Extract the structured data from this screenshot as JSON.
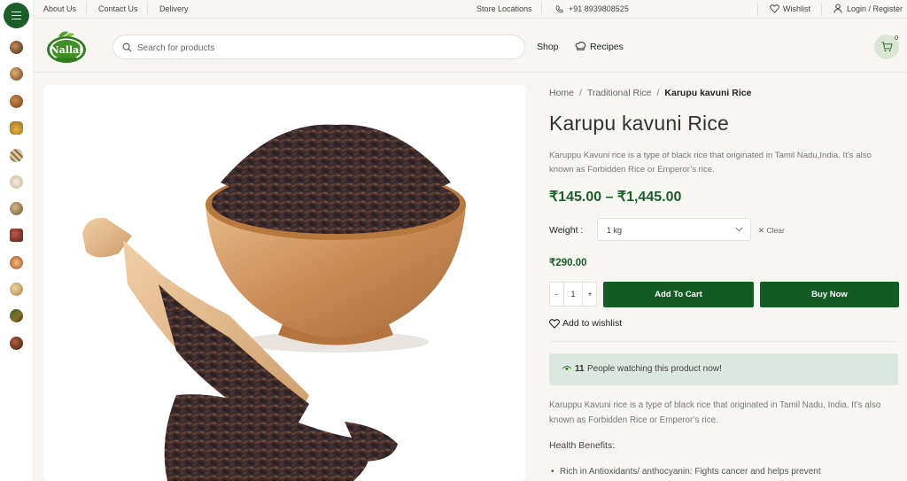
{
  "topbar": {
    "about": "About Us",
    "contact": "Contact Us",
    "delivery": "Delivery",
    "stores": "Store Locations",
    "phone": "+91 8939808525",
    "wishlist": "Wishlist",
    "login": "Login / Register"
  },
  "header": {
    "logo_text": "Nallal",
    "search_placeholder": "Search for products",
    "nav_shop": "Shop",
    "nav_recipes": "Recipes",
    "cart_count": "0"
  },
  "sidebar": {
    "category_count": 12
  },
  "product": {
    "breadcrumb": [
      "Home",
      "Traditional Rice",
      "Karupu kavuni Rice"
    ],
    "title": "Karupu kavuni Rice",
    "short_desc": "Karuppu Kavuni rice is a type of black rice that originated in Tamil Nadu,India. It’s also known as Forbidden Rice or Emperor’s rice.",
    "price_range": "₹145.00 – ₹1,445.00",
    "weight_label": "Weight :",
    "weight_selected": "1 kg",
    "clear_label": "Clear",
    "variation_price": "₹290.00",
    "qty_minus": "-",
    "qty_value": "1",
    "qty_plus": "+",
    "add_to_cart": "Add To Cart",
    "buy_now": "Buy Now",
    "add_to_wishlist": "Add to wishlist",
    "watching_count": "11",
    "watching_text": "People watching this product now!",
    "long_desc": "Karuppu Kavuni rice is a type of black rice that originated in Tamil Nadu, India. It’s also known as Forbidden Rice or Emperor’s rice.",
    "health_title": "Health Benefits:",
    "benefits": [
      "Rich in Antioxidants/ anthocyanin:  Fights cancer  and helps prevent"
    ]
  },
  "colors": {
    "brand_green": "#155b25",
    "price_green": "#1b5e2a",
    "watch_bg": "#dce7df"
  }
}
